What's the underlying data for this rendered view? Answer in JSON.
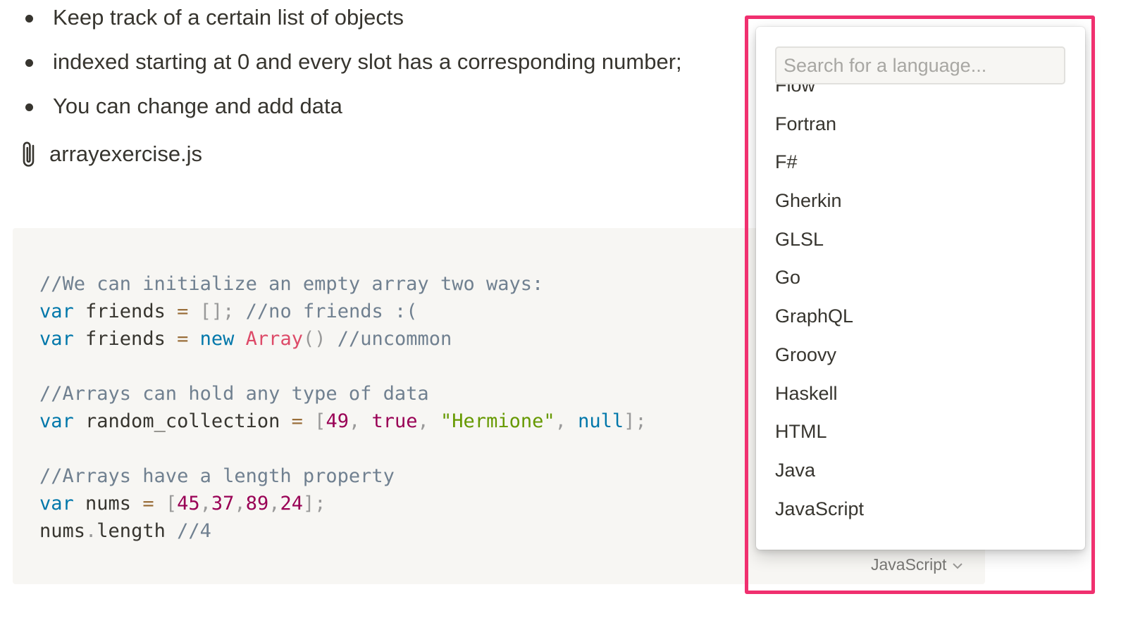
{
  "bullets": [
    "Keep track of a certain list of objects",
    "indexed starting at 0 and every slot has a corresponding number;",
    "You can change and add data"
  ],
  "attachment": {
    "icon": "paperclip-icon",
    "filename": "arrayexercise.js"
  },
  "code_block": {
    "lines": [
      [
        {
          "t": "comment",
          "v": "//We can initialize an empty array two ways:"
        }
      ],
      [
        {
          "t": "keyword",
          "v": "var"
        },
        {
          "t": "plain",
          "v": " friends "
        },
        {
          "t": "operator",
          "v": "="
        },
        {
          "t": "plain",
          "v": " "
        },
        {
          "t": "punct",
          "v": "[];"
        },
        {
          "t": "plain",
          "v": " "
        },
        {
          "t": "comment",
          "v": "//no friends :("
        }
      ],
      [
        {
          "t": "keyword",
          "v": "var"
        },
        {
          "t": "plain",
          "v": " friends "
        },
        {
          "t": "operator",
          "v": "="
        },
        {
          "t": "plain",
          "v": " "
        },
        {
          "t": "keyword",
          "v": "new"
        },
        {
          "t": "plain",
          "v": " "
        },
        {
          "t": "class",
          "v": "Array"
        },
        {
          "t": "punct",
          "v": "()"
        },
        {
          "t": "plain",
          "v": " "
        },
        {
          "t": "comment",
          "v": "//uncommon"
        }
      ],
      [],
      [
        {
          "t": "comment",
          "v": "//Arrays can hold any type of data"
        }
      ],
      [
        {
          "t": "keyword",
          "v": "var"
        },
        {
          "t": "plain",
          "v": " random_collection "
        },
        {
          "t": "operator",
          "v": "="
        },
        {
          "t": "plain",
          "v": " "
        },
        {
          "t": "punct",
          "v": "["
        },
        {
          "t": "number",
          "v": "49"
        },
        {
          "t": "punct",
          "v": ","
        },
        {
          "t": "plain",
          "v": " "
        },
        {
          "t": "boolean",
          "v": "true"
        },
        {
          "t": "punct",
          "v": ","
        },
        {
          "t": "plain",
          "v": " "
        },
        {
          "t": "string",
          "v": "\"Hermione\""
        },
        {
          "t": "punct",
          "v": ","
        },
        {
          "t": "plain",
          "v": " "
        },
        {
          "t": "keyword",
          "v": "null"
        },
        {
          "t": "punct",
          "v": "];"
        }
      ],
      [],
      [
        {
          "t": "comment",
          "v": "//Arrays have a length property"
        }
      ],
      [
        {
          "t": "keyword",
          "v": "var"
        },
        {
          "t": "plain",
          "v": " nums "
        },
        {
          "t": "operator",
          "v": "="
        },
        {
          "t": "plain",
          "v": " "
        },
        {
          "t": "punct",
          "v": "["
        },
        {
          "t": "number",
          "v": "45"
        },
        {
          "t": "punct",
          "v": ","
        },
        {
          "t": "number",
          "v": "37"
        },
        {
          "t": "punct",
          "v": ","
        },
        {
          "t": "number",
          "v": "89"
        },
        {
          "t": "punct",
          "v": ","
        },
        {
          "t": "number",
          "v": "24"
        },
        {
          "t": "punct",
          "v": "];"
        }
      ],
      [
        {
          "t": "plain",
          "v": "nums"
        },
        {
          "t": "punct",
          "v": "."
        },
        {
          "t": "plain",
          "v": "length "
        },
        {
          "t": "comment",
          "v": "//4"
        }
      ]
    ],
    "language_button": "JavaScript"
  },
  "language_menu": {
    "search_placeholder": "Search for a language...",
    "search_value": "",
    "languages": [
      "Flow",
      "Fortran",
      "F#",
      "Gherkin",
      "GLSL",
      "Go",
      "GraphQL",
      "Groovy",
      "Haskell",
      "HTML",
      "Java",
      "JavaScript"
    ]
  },
  "colors": {
    "highlight": "#f0306f",
    "code_background": "#f7f6f3",
    "text": "#37352f"
  }
}
